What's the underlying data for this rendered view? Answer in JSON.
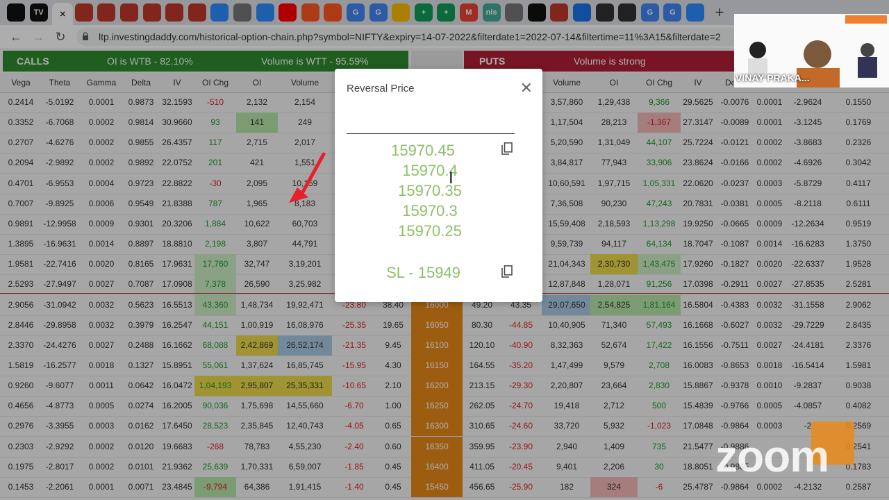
{
  "browser": {
    "url": "ltp.investingdaddy.com/historical-option-chain.php?symbol=NIFTY&expiry=14-07-2022&filterdate1=2022-07-14&filtertime=11%3A15&filterdate=2",
    "tabs": [
      {
        "icon": "tradingview-icon",
        "color": "#111111",
        "label": ""
      },
      {
        "icon": "tv-icon",
        "color": "#111111",
        "label": "TV"
      },
      {
        "icon": "close-icon",
        "color": "#ffffff",
        "label": "✕",
        "active": true
      },
      {
        "icon": "pin-icon",
        "color": "#c0392b",
        "label": ""
      },
      {
        "icon": "pin-icon",
        "color": "#c0392b",
        "label": ""
      },
      {
        "icon": "pin-icon",
        "color": "#c0392b",
        "label": ""
      },
      {
        "icon": "pin-icon",
        "color": "#c0392b",
        "label": ""
      },
      {
        "icon": "pin-icon",
        "color": "#c0392b",
        "label": ""
      },
      {
        "icon": "pin-icon",
        "color": "#c0392b",
        "label": ""
      },
      {
        "icon": "zoom-icon",
        "color": "#2d8cff",
        "label": ""
      },
      {
        "icon": "globe-icon",
        "color": "#777777",
        "label": ""
      },
      {
        "icon": "zoom-icon",
        "color": "#2d8cff",
        "label": ""
      },
      {
        "icon": "youtube-icon",
        "color": "#ff0000",
        "label": ""
      },
      {
        "icon": "bolt-icon",
        "color": "#ff5722",
        "label": ""
      },
      {
        "icon": "bolt-icon",
        "color": "#ff5722",
        "label": ""
      },
      {
        "icon": "google-icon",
        "color": "#4285f4",
        "label": "G"
      },
      {
        "icon": "google-icon",
        "color": "#4285f4",
        "label": "G"
      },
      {
        "icon": "drive-icon",
        "color": "#fbbc04",
        "label": ""
      },
      {
        "icon": "plus-square-icon",
        "color": "#0f9d58",
        "label": "+"
      },
      {
        "icon": "plus-square-icon",
        "color": "#0f9d58",
        "label": "+"
      },
      {
        "icon": "gmail-icon",
        "color": "#ea4335",
        "label": "M"
      },
      {
        "icon": "nis-icon",
        "color": "#4a9",
        "label": "nis"
      },
      {
        "icon": "globe-icon",
        "color": "#777777",
        "label": ""
      },
      {
        "icon": "tv-icon",
        "color": "#111111",
        "label": ""
      },
      {
        "icon": "doc-icon",
        "color": "#c0392b",
        "label": ""
      },
      {
        "icon": "info-icon",
        "color": "#1a73e8",
        "label": ""
      },
      {
        "icon": "github-icon",
        "color": "#333333",
        "label": ""
      },
      {
        "icon": "github-icon",
        "color": "#333333",
        "label": ""
      },
      {
        "icon": "google-icon",
        "color": "#4285f4",
        "label": "G"
      },
      {
        "icon": "google-icon",
        "color": "#4285f4",
        "label": "G"
      },
      {
        "icon": "zoom-icon",
        "color": "#2d8cff",
        "label": ""
      }
    ]
  },
  "bars": {
    "calls_label": "CALLS",
    "oi_text": "OI is WTB - 82.10%",
    "volume_text": "Volume is WTT - 95.59%",
    "puts_label": "PUTS",
    "puts_volume_text": "Volume is strong"
  },
  "headers": [
    "Vega",
    "Theta",
    "Gamma",
    "Delta",
    "IV",
    "OI Chg",
    "OI",
    "Volume",
    "Volume",
    "OI",
    "OI Chg",
    "IV",
    "Delta"
  ],
  "rows": [
    {
      "c": [
        "0.2414",
        "-5.0192",
        "0.0001",
        "0.9873",
        "32.1593",
        "-510",
        "2,132",
        "2,154"
      ],
      "p": [
        "3,57,860",
        "1,29,438",
        "9,366",
        "29.5625",
        "-0.0076",
        "0.0001",
        "-2.9624",
        "0.1550"
      ]
    },
    {
      "c": [
        "0.3352",
        "-6.7068",
        "0.0002",
        "0.9814",
        "30.9660",
        "93",
        "141",
        "249"
      ],
      "p": [
        "1,17,504",
        "28,213",
        "-1,367",
        "27.3147",
        "-0.0089",
        "0.0001",
        "-3.1245",
        "0.1769"
      ]
    },
    {
      "c": [
        "0.2707",
        "-4.6276",
        "0.0002",
        "0.9855",
        "26.4357",
        "117",
        "2,715",
        "2,017"
      ],
      "p": [
        "5,20,590",
        "1,31,049",
        "44,107",
        "25.7224",
        "-0.0121",
        "0.0002",
        "-3.8683",
        "0.2326"
      ]
    },
    {
      "c": [
        "0.2094",
        "-2.9892",
        "0.0002",
        "0.9892",
        "22.0752",
        "201",
        "421",
        "1,551"
      ],
      "p": [
        "3,84,817",
        "77,943",
        "33,906",
        "23.8624",
        "-0.0166",
        "0.0002",
        "-4.6926",
        "0.3042"
      ]
    },
    {
      "c": [
        "0.4701",
        "-6.9553",
        "0.0004",
        "0.9723",
        "22.8822",
        "-30",
        "2,095",
        "10,159"
      ],
      "p": [
        "10,60,591",
        "1,97,715",
        "1,05,331",
        "22.0620",
        "-0.0237",
        "0.0003",
        "-5.8729",
        "0.4117"
      ]
    },
    {
      "c": [
        "0.7007",
        "-9.8925",
        "0.0006",
        "0.9549",
        "21.8388",
        "787",
        "1,965",
        "8,183"
      ],
      "p": [
        "7,36,508",
        "90,230",
        "47,243",
        "20.7831",
        "-0.0381",
        "0.0005",
        "-8.2118",
        "0.6111"
      ]
    },
    {
      "c": [
        "0.9891",
        "-12.9958",
        "0.0009",
        "0.9301",
        "20.3206",
        "1,884",
        "10,622",
        "60,703"
      ],
      "p": [
        "15,59,408",
        "2,18,593",
        "1,13,298",
        "19.9250",
        "-0.0665",
        "0.0009",
        "-12.2634",
        "0.9519"
      ]
    },
    {
      "c": [
        "1.3895",
        "-16.9631",
        "0.0014",
        "0.8897",
        "18.8810",
        "2,198",
        "3,807",
        "44,791"
      ],
      "p": [
        "9,59,739",
        "94,117",
        "64,134",
        "18.7047",
        "-0.1087",
        "0.0014",
        "-16.6283",
        "1.3750"
      ]
    },
    {
      "c": [
        "1.9581",
        "-22.7416",
        "0.0020",
        "0.8165",
        "17.9631",
        "17,760",
        "32,747",
        "3,19,201"
      ],
      "p": [
        "21,04,343",
        "2,30,730",
        "1,43,475",
        "17.9260",
        "-0.1827",
        "0.0020",
        "-22.6337",
        "1.9528"
      ]
    },
    {
      "c": [
        "2.5293",
        "-27.9497",
        "0.0027",
        "0.7087",
        "17.0908",
        "7,378",
        "26,590",
        "3,25,982"
      ],
      "p": [
        "12,87,848",
        "1,28,071",
        "91,256",
        "17.0398",
        "-0.2911",
        "0.0027",
        "-27.8535",
        "2.5281"
      ]
    },
    {
      "c": [
        "2.9056",
        "-31.0942",
        "0.0032",
        "0.5623",
        "16.5513",
        "43,360",
        "1,48,734",
        "19,92,471"
      ],
      "m": [
        "-23.80",
        "38.40",
        "16000",
        "49.20",
        "43.35"
      ],
      "p": [
        "29,07,650",
        "2,54,825",
        "1,81,164",
        "16.5804",
        "-0.4383",
        "0.0032",
        "-31.1558",
        "2.9062"
      ]
    },
    {
      "c": [
        "2.8446",
        "-29.8958",
        "0.0032",
        "0.3979",
        "16.2547",
        "44,151",
        "1,00,919",
        "16,08,976"
      ],
      "m": [
        "-25.35",
        "19.65",
        "16050",
        "80.30",
        "-44.85"
      ],
      "p": [
        "10,40,905",
        "71,340",
        "57,493",
        "16.1668",
        "-0.6027",
        "0.0032",
        "-29.7229",
        "2.8435"
      ]
    },
    {
      "c": [
        "2.3370",
        "-24.4276",
        "0.0027",
        "0.2488",
        "16.1662",
        "68,088",
        "2,42,869",
        "26,52,174"
      ],
      "m": [
        "-21.35",
        "9.45",
        "16100",
        "120.10",
        "-40.90"
      ],
      "p": [
        "8,32,363",
        "52,674",
        "17,422",
        "16.1556",
        "-0.7511",
        "0.0027",
        "-24.4181",
        "2.3376"
      ]
    },
    {
      "c": [
        "1.5819",
        "-16.2577",
        "0.0018",
        "0.1327",
        "15.8951",
        "55,061",
        "1,37,624",
        "16,85,745"
      ],
      "m": [
        "-15.95",
        "4.30",
        "16150",
        "164.55",
        "-35.20"
      ],
      "p": [
        "1,47,499",
        "9,579",
        "2,708",
        "16.0083",
        "-0.8653",
        "0.0018",
        "-16.5414",
        "1.5981"
      ]
    },
    {
      "c": [
        "0.9260",
        "-9.6077",
        "0.0011",
        "0.0642",
        "16.0472",
        "1,04,193",
        "2,95,807",
        "25,35,331"
      ],
      "m": [
        "-10.65",
        "2.10",
        "16200",
        "213.15",
        "-29.30"
      ],
      "p": [
        "2,20,807",
        "23,664",
        "2,830",
        "15.8867",
        "-0.9378",
        "0.0010",
        "-9.2837",
        "0.9038"
      ]
    },
    {
      "c": [
        "0.4656",
        "-4.8773",
        "0.0005",
        "0.0274",
        "16.2005",
        "90,036",
        "1,75,698",
        "14,55,660"
      ],
      "m": [
        "-6.70",
        "1.00",
        "16250",
        "262.05",
        "-24.70"
      ],
      "p": [
        "19,418",
        "2,712",
        "500",
        "15.4839",
        "-0.9766",
        "0.0005",
        "-4.0857",
        "0.4082"
      ]
    },
    {
      "c": [
        "0.2976",
        "-3.3955",
        "0.0003",
        "0.0162",
        "17.6450",
        "28,523",
        "2,35,845",
        "12,40,743"
      ],
      "m": [
        "-4.05",
        "0.65",
        "16300",
        "310.65",
        "-24.60"
      ],
      "p": [
        "33,720",
        "5,932",
        "-1,023",
        "17.0848",
        "-0.9864",
        "0.0003",
        "-2",
        "0.2569"
      ]
    },
    {
      "c": [
        "0.2303",
        "-2.9292",
        "0.0002",
        "0.0120",
        "19.6683",
        "-268",
        "78,783",
        "4,55,230"
      ],
      "m": [
        "-2.40",
        "0.60",
        "16350",
        "359.95",
        "-23.90"
      ],
      "p": [
        "2,940",
        "1,409",
        "735",
        "21.5477",
        "-0.9886",
        "",
        "",
        "0.2541"
      ]
    },
    {
      "c": [
        "0.1975",
        "-2.8017",
        "0.0002",
        "0.0101",
        "21.9362",
        "25,639",
        "1,70,331",
        "6,59,007"
      ],
      "m": [
        "-1.85",
        "0.45",
        "16400",
        "411.05",
        "-20.45"
      ],
      "p": [
        "9,401",
        "2,206",
        "30",
        "18.8051",
        "-0.9865",
        "",
        "",
        "0.1783"
      ]
    },
    {
      "c": [
        "0.1453",
        "-2.2061",
        "0.0001",
        "0.0071",
        "23.4845",
        "-9,794",
        "64,386",
        "1,91,415"
      ],
      "m": [
        "-1.40",
        "0.45",
        "15450",
        "456.65",
        "-25.90"
      ],
      "p": [
        "182",
        "324",
        "-6",
        "25.4787",
        "-0.9864",
        "0.0002",
        "-4.2132",
        "0.2587"
      ]
    }
  ],
  "modal": {
    "title": "Reversal Price",
    "prices": [
      "15970.45",
      "15970.4",
      "15970.35",
      "15970.3",
      "15970.25"
    ],
    "sl": "SL - 15949"
  },
  "video": {
    "label": "VINAY PRAKA..."
  },
  "watermark": "zoom",
  "colors": {
    "calls_bar": "#2e8b2e",
    "puts_bar": "#b02035",
    "strike": "#e88a1a",
    "price_green": "#8cc066"
  }
}
